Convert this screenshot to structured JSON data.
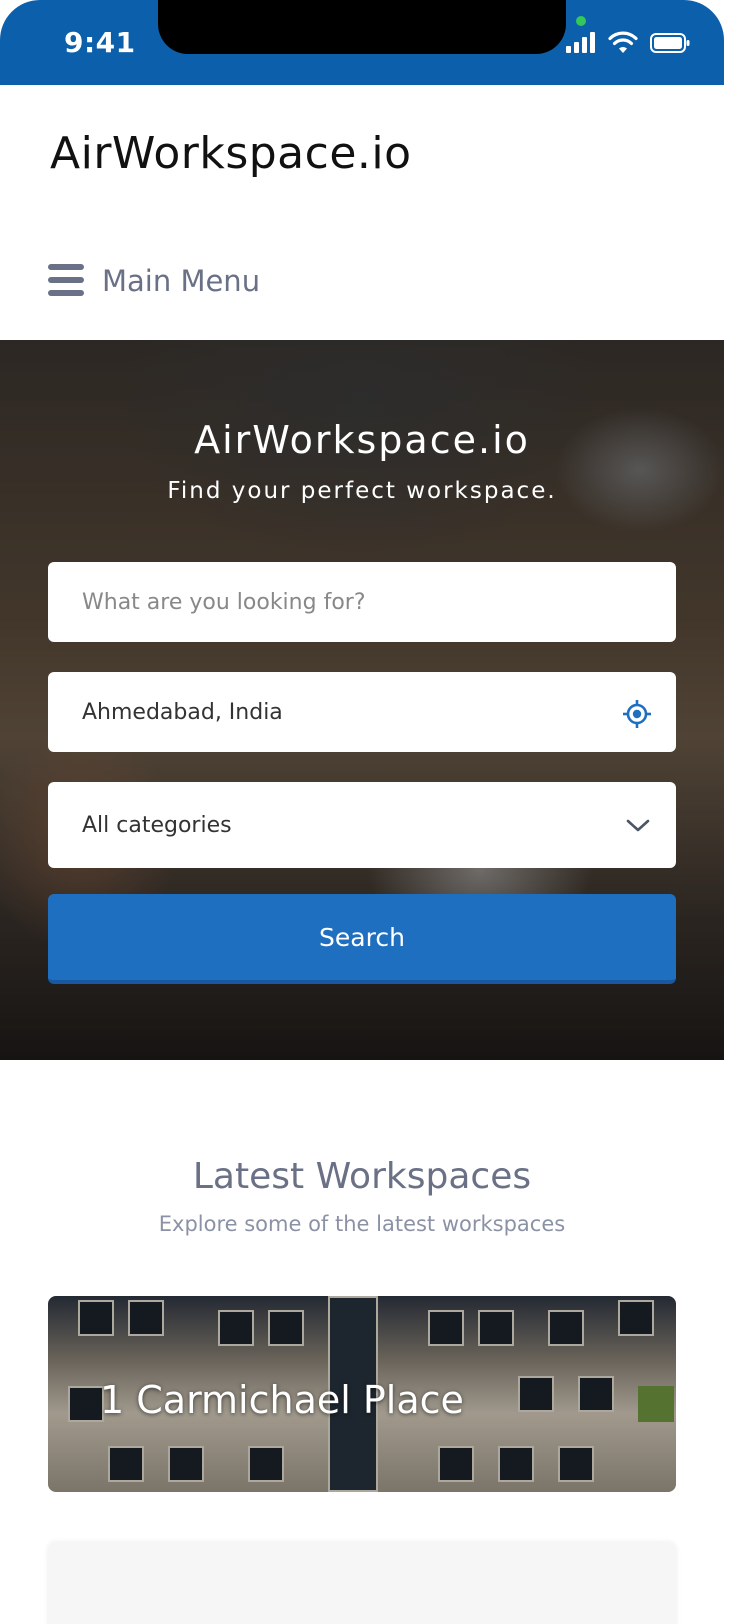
{
  "status_bar": {
    "time": "9:41",
    "background": "#0c5fab"
  },
  "header": {
    "brand": "AirWorkspace.io",
    "menu_label": "Main Menu"
  },
  "hero": {
    "title": "AirWorkspace.io",
    "subtitle": "Find your perfect workspace.",
    "search_placeholder": "What are you looking for?",
    "location_value": "Ahmedabad, India",
    "category_value": "All categories",
    "search_button": "Search",
    "accent": "#1f6fc1"
  },
  "latest": {
    "title": "Latest Workspaces",
    "subtitle": "Explore some of the latest workspaces",
    "cards": [
      {
        "title": "1 Carmichael Place"
      }
    ]
  }
}
